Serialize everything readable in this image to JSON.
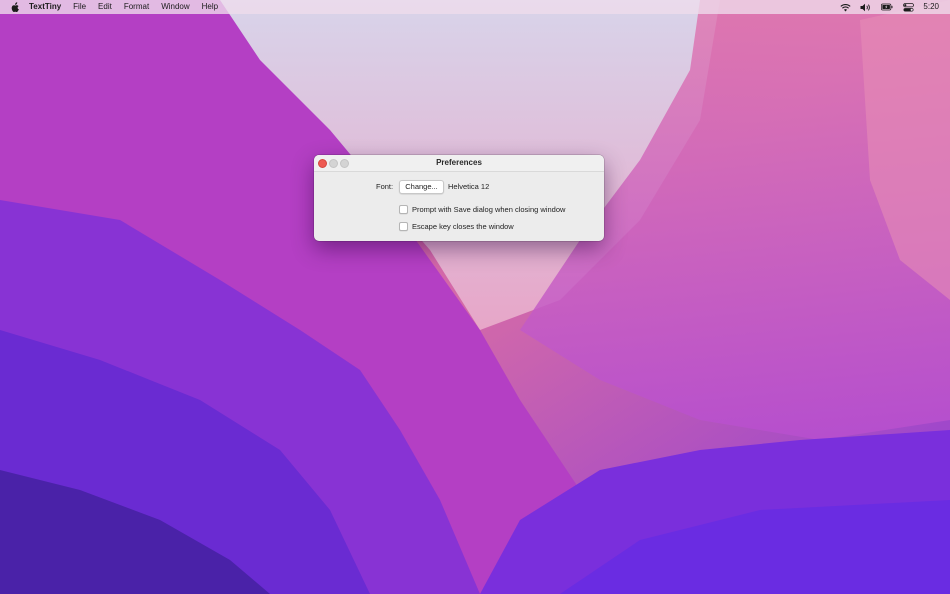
{
  "menubar": {
    "apple_icon": "apple-logo-icon",
    "app_name": "TextTiny",
    "menus": [
      "File",
      "Edit",
      "Format",
      "Window",
      "Help"
    ],
    "status_icons": [
      "wifi-icon",
      "volume-icon",
      "battery-icon",
      "control-center-icon"
    ],
    "clock": "5:20"
  },
  "window": {
    "title": "Preferences",
    "font_label": "Font:",
    "change_button": "Change...",
    "font_value": "Helvetica 12",
    "options": [
      {
        "label": "Prompt with Save dialog when closing window",
        "checked": false
      },
      {
        "label": "Escape key closes the window",
        "checked": false
      }
    ]
  },
  "colors": {
    "close_button": "#ee5a52",
    "window_bg": "#ececec"
  }
}
